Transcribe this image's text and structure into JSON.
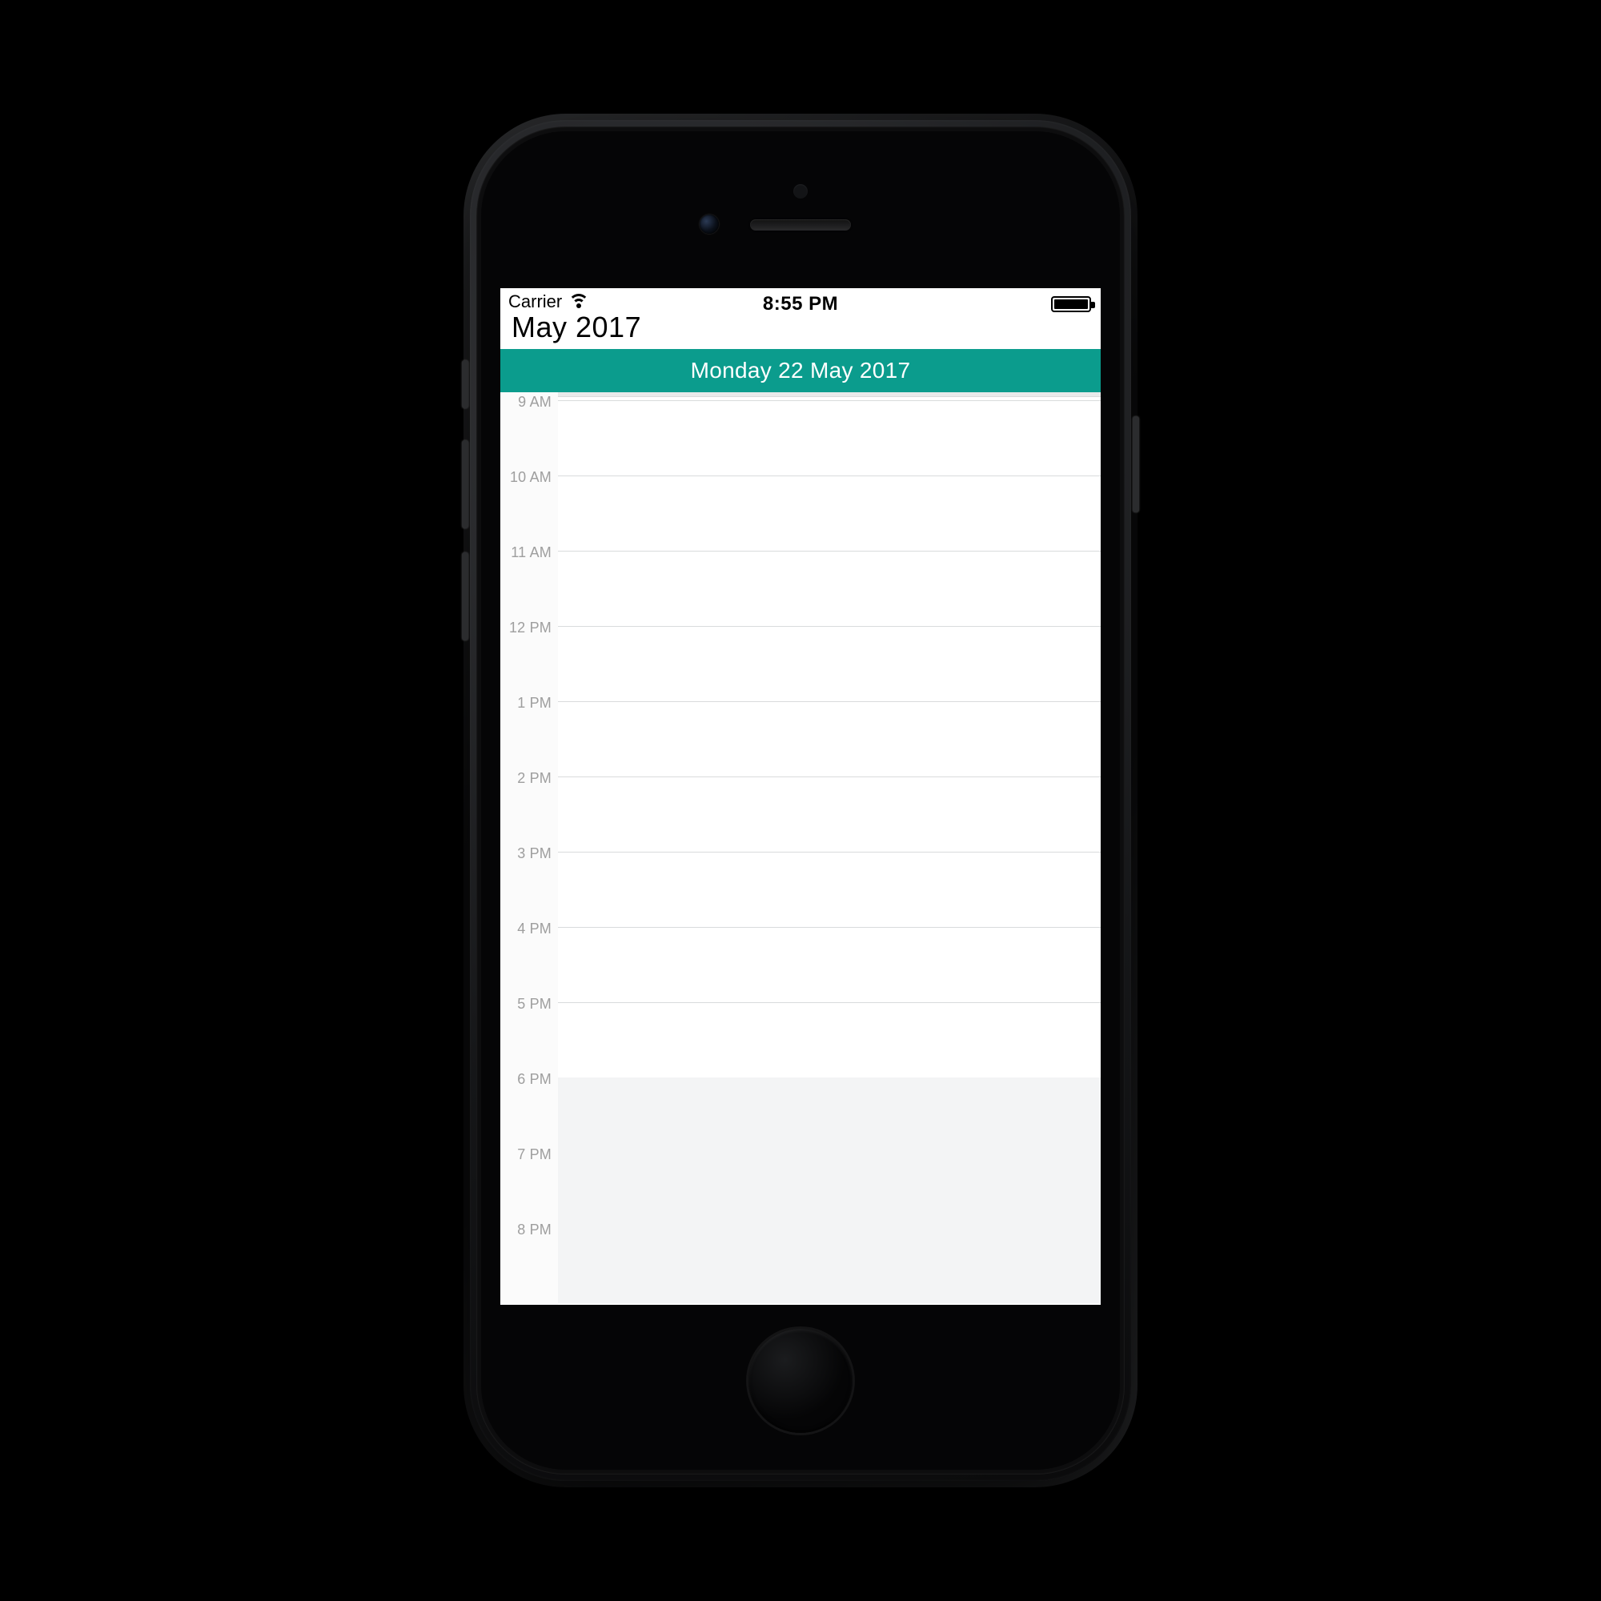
{
  "statusbar": {
    "carrier": "Carrier",
    "time": "8:55 PM"
  },
  "header": {
    "month_title": "May 2017",
    "date_header": "Monday  22 May 2017"
  },
  "schedule": {
    "visible_hours": [
      {
        "label": "9 AM",
        "off_hours": false
      },
      {
        "label": "10 AM",
        "off_hours": false
      },
      {
        "label": "11 AM",
        "off_hours": false
      },
      {
        "label": "12 PM",
        "off_hours": false
      },
      {
        "label": "1 PM",
        "off_hours": false
      },
      {
        "label": "2 PM",
        "off_hours": false
      },
      {
        "label": "3 PM",
        "off_hours": false
      },
      {
        "label": "4 PM",
        "off_hours": false
      },
      {
        "label": "5 PM",
        "off_hours": false
      },
      {
        "label": "6 PM",
        "off_hours": true
      },
      {
        "label": "7 PM",
        "off_hours": true
      },
      {
        "label": "8 PM",
        "off_hours": true
      }
    ]
  },
  "colors": {
    "accent": "#0b9c8d",
    "off_hours_bg": "#f3f4f5",
    "grid_line": "#d9dbdc"
  }
}
